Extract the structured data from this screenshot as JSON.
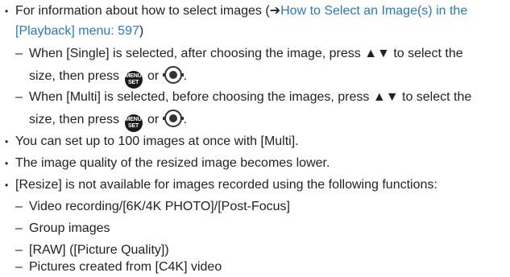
{
  "bullets": [
    {
      "prefix": "For information about how to select images (",
      "arrow": "➔",
      "link_line1": "How to Select an Image(s) in the",
      "link_line2": "[Playback] menu: 597",
      "suffix": ")"
    },
    {
      "text": "You can set up to 100 images at once with [Multi]."
    },
    {
      "text": "The image quality of the resized image becomes lower."
    },
    {
      "text": "[Resize] is not available for images recorded using the following functions:"
    }
  ],
  "sub_single": {
    "line1": "When [Single] is selected, after choosing the image, press ▲▼ to select the",
    "line2_pre": "size, then press",
    "or": "or",
    "end": "."
  },
  "sub_multi": {
    "line1": "When [Multi] is selected, before choosing the images, press ▲▼ to select the",
    "line2_pre": "size, then press",
    "or": "or",
    "end": "."
  },
  "functions": [
    "Video recording/[6K/4K PHOTO]/[Post-Focus]",
    "Group images",
    "[RAW] ([Picture Quality])",
    "Pictures created from [C4K] video"
  ],
  "glyphs": {
    "bullet": "•",
    "dash": "–"
  },
  "icons": {
    "menu_set": "MENU SET button",
    "dial": "control dial",
    "menu_label_top": "MENU",
    "menu_label_bottom": "SET"
  },
  "colors": {
    "link": "#2a78c4",
    "text": "#222222"
  }
}
